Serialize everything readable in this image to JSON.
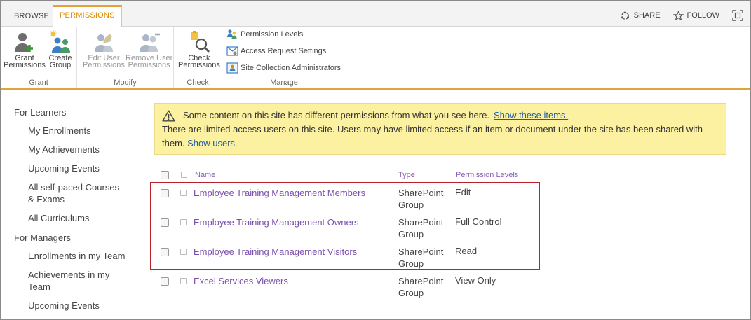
{
  "tabs": {
    "browse": "BROWSE",
    "permissions": "PERMISSIONS"
  },
  "top_actions": {
    "share": "SHARE",
    "follow": "FOLLOW"
  },
  "ribbon": {
    "grant": {
      "label": "Grant",
      "grant_permissions": [
        "Grant",
        "Permissions"
      ],
      "create_group": [
        "Create",
        "Group"
      ]
    },
    "modify": {
      "label": "Modify",
      "edit_user_permissions": [
        "Edit User",
        "Permissions"
      ],
      "remove_user_permissions": [
        "Remove User",
        "Permissions"
      ]
    },
    "check": {
      "label": "Check",
      "check_permissions": [
        "Check",
        "Permissions"
      ]
    },
    "manage": {
      "label": "Manage",
      "permission_levels": "Permission Levels",
      "access_request_settings": "Access Request Settings",
      "site_collection_admins": "Site Collection Administrators"
    }
  },
  "leftnav": {
    "learners_heading": "For Learners",
    "learners": [
      "My Enrollments",
      "My Achievements",
      "Upcoming Events",
      "All self-paced Courses",
      "& Exams",
      "All Curriculums"
    ],
    "managers_heading": "For Managers",
    "managers": [
      "Enrollments in my Team",
      "Achievements in my",
      "Team",
      "Upcoming Events"
    ]
  },
  "warning": {
    "line1": "Some content on this site has different permissions from what you see here.",
    "line1_link": "Show these items.",
    "line2": "There are limited access users on this site. Users may have limited access if an item or document under the site has been shared with",
    "line3_prefix": "them.",
    "line3_link": "Show users."
  },
  "table": {
    "headers": {
      "name": "Name",
      "type": "Type",
      "permission_levels": "Permission Levels"
    },
    "rows": [
      {
        "name": "Employee Training Management Members",
        "type": [
          "SharePoint",
          "Group"
        ],
        "permission": "Edit"
      },
      {
        "name": "Employee Training Management Owners",
        "type": [
          "SharePoint",
          "Group"
        ],
        "permission": "Full Control"
      },
      {
        "name": "Employee Training Management Visitors",
        "type": [
          "SharePoint",
          "Group"
        ],
        "permission": "Read"
      },
      {
        "name": "Excel Services Viewers",
        "type": [
          "SharePoint",
          "Group"
        ],
        "permission": "View Only"
      }
    ]
  },
  "colors": {
    "accent": "#e6a23a",
    "link": "#7a4fad",
    "warning_bg": "#fcf0a1",
    "highlight": "#b8222a"
  }
}
